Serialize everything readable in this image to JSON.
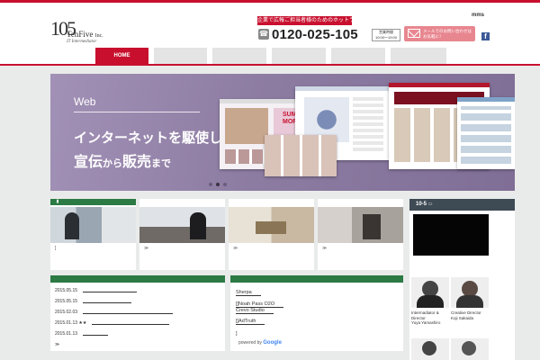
{
  "header": {
    "logo_num": "105",
    "logo_brand": "TenFive",
    "logo_brand_suffix": "Inc.",
    "logo_sub": "IT Intermediator",
    "top_link": "mms",
    "tagline": "企業で広報ご担当者様のためのホットライン",
    "phone": "0120-025-105",
    "hours_label": "営業時間",
    "hours_value": "10:00〜19:00",
    "mail_label": "メールでのお問い合わせはお気軽に！"
  },
  "nav": {
    "active_label": "HOME"
  },
  "hero": {
    "category": "Web",
    "line1": "インターネットを駆使して",
    "line2_a": "宣伝",
    "line2_b": "から",
    "line2_c": "販売",
    "line2_d": "まで",
    "shot_text": "SUMMER MORE! SALE"
  },
  "cards": [
    {
      "text": "]"
    },
    {
      "text": "≫"
    },
    {
      "text": "≫"
    },
    {
      "text": "≫"
    }
  ],
  "news": [
    {
      "date": "2015.05.15"
    },
    {
      "date": "2015.05.15"
    },
    {
      "date": "2015.02.03"
    },
    {
      "date": "2015.01.13",
      "mark": "★★"
    },
    {
      "date": "2015.01.13"
    }
  ],
  "news_more": "≫",
  "links": {
    "items": [
      "Sherpa",
      "[]Noah Pass O2O",
      "Crevo Studio",
      "[]AdTruth",
      "]"
    ],
    "powered": "powered by"
  },
  "side": {
    "title": "10-5",
    "people": [
      {
        "role": "Intermadiator &\nDirector",
        "name": "Yuya Yamashiro"
      },
      {
        "role": "Creative Director",
        "name": "Koji Sakaida"
      }
    ]
  },
  "colors": {
    "brand": "#c8102e",
    "green": "#2c7a44",
    "hero": "#8f7fa3"
  }
}
